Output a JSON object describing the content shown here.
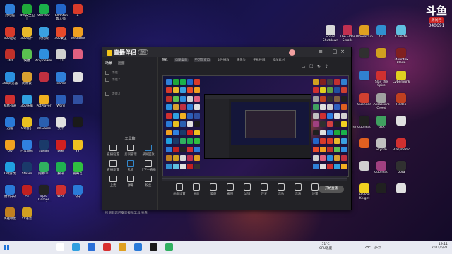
{
  "desktop": {
    "left_icons": [
      {
        "label": "此电脑",
        "color": "#2f7fd8",
        "icon": "computer-icon"
      },
      {
        "label": "360安全卫士",
        "color": "#1fa83a",
        "icon": "shield-icon"
      },
      {
        "label": "WeChat",
        "color": "#1ab04b",
        "icon": "chat-icon"
      },
      {
        "label": "UPIdoten 鲁大师",
        "color": "#2366c9",
        "icon": "app-icon"
      },
      {
        "label": "e",
        "color": "#d83a2a",
        "icon": "app-icon"
      },
      {
        "label": "360驱动",
        "color": "#d83a2a",
        "icon": "app-icon"
      },
      {
        "label": "360软件",
        "color": "#e8b82a",
        "icon": "app-icon"
      },
      {
        "label": "同花顺",
        "color": "#3aa0e0",
        "icon": "app-icon"
      },
      {
        "label": "360安全",
        "color": "#e84a2a",
        "icon": "app-icon"
      },
      {
        "label": "WeGame",
        "color": "#f0a020",
        "icon": "game-icon"
      },
      {
        "label": "360",
        "color": "#c0302a",
        "icon": "app-icon"
      },
      {
        "label": "快捷",
        "color": "#5ac050",
        "icon": "app-icon"
      },
      {
        "label": "AnyViewer",
        "color": "#2f8fe0",
        "icon": "app-icon"
      },
      {
        "label": "111",
        "color": "#d0d0d0",
        "icon": "file-icon"
      },
      {
        "label": "",
        "color": "#e06080",
        "icon": "app-icon"
      },
      {
        "label": "360浏览器",
        "color": "#2a90e0",
        "icon": "browser-icon"
      },
      {
        "label": "网易云",
        "color": "#d8a030",
        "icon": "app-icon"
      },
      {
        "label": "",
        "color": "#c03040",
        "icon": "app-icon"
      },
      {
        "label": "TeamV",
        "color": "#2f7fd8",
        "icon": "app-icon"
      },
      {
        "label": "",
        "color": "#e0e0e0",
        "icon": "file-icon"
      },
      {
        "label": "网易有道",
        "color": "#d03030",
        "icon": "app-icon"
      },
      {
        "label": "360压缩",
        "color": "#30a0e0",
        "icon": "app-icon"
      },
      {
        "label": "PotPlayer",
        "color": "#f0b020",
        "icon": "app-icon"
      },
      {
        "label": "Word",
        "color": "#2b5fb8",
        "icon": "doc-icon"
      },
      {
        "label": "",
        "color": "#3050a0",
        "icon": "app-icon"
      },
      {
        "label": "迅雷",
        "color": "#2a7ad8",
        "icon": "app-icon"
      },
      {
        "label": "QQ音乐",
        "color": "#e8c020",
        "icon": "music-icon"
      },
      {
        "label": "WeGame",
        "color": "#2a5fb0",
        "icon": "app-icon"
      },
      {
        "label": "文件",
        "color": "#e0e0e0",
        "icon": "file-icon"
      },
      {
        "label": "",
        "color": "#1a1a1a",
        "icon": "app-icon"
      },
      {
        "label": "QQ",
        "color": "#f0a020",
        "icon": "app-icon"
      },
      {
        "label": "百度网盘",
        "color": "#3080e0",
        "icon": "app-icon"
      },
      {
        "label": "Steam",
        "color": "#1a3a6a",
        "icon": "app-icon"
      },
      {
        "label": "网易",
        "color": "#d02020",
        "icon": "app-icon"
      },
      {
        "label": "YY",
        "color": "#f0c020",
        "icon": "app-icon"
      },
      {
        "label": "QQ游戏",
        "color": "#20a0e0",
        "icon": "app-icon"
      },
      {
        "label": "Steam",
        "color": "#1a3a6a",
        "icon": "app-icon"
      },
      {
        "label": "网易UU",
        "color": "#30b060",
        "icon": "app-icon"
      },
      {
        "label": "腾讯",
        "color": "#20b050",
        "icon": "app-icon"
      },
      {
        "label": "爱奇艺",
        "color": "#30c040",
        "icon": "app-icon"
      },
      {
        "label": "腾讯QQ",
        "color": "#2a7ad8",
        "icon": "app-icon"
      },
      {
        "label": "PS",
        "color": "#c02020",
        "icon": "app-icon"
      },
      {
        "label": "Epic Games Launcher",
        "color": "#222222",
        "icon": "app-icon"
      },
      {
        "label": "WPS",
        "color": "#d03030",
        "icon": "app-icon"
      },
      {
        "label": "QQ",
        "color": "#2a7ad8",
        "icon": "app-icon"
      },
      {
        "label": "英雄联盟",
        "color": "#c08020",
        "icon": "app-icon"
      },
      {
        "label": "YY语音",
        "color": "#d0a020",
        "icon": "app-icon"
      }
    ],
    "right_icons": [
      {
        "label": "Space Shutdown",
        "color": "#d8d8d8",
        "icon": "app-icon"
      },
      {
        "label": "The Elder Scrolls",
        "color": "#c03050",
        "icon": "game-icon"
      },
      {
        "label": "Bloodstained",
        "color": "#e0a020",
        "icon": "game-icon"
      },
      {
        "label": "Ori",
        "color": "#3090d0",
        "icon": "game-icon"
      },
      {
        "label": "Celeste",
        "color": "#60c0e0",
        "icon": "game-icon"
      },
      {
        "label": "Hollow Knight",
        "color": "#e0e0e0",
        "icon": "game-icon"
      },
      {
        "label": "",
        "color": "#c02020",
        "icon": "game-icon"
      },
      {
        "label": "",
        "color": "#303030",
        "icon": "game-icon"
      },
      {
        "label": "",
        "color": "#d0a020",
        "icon": "game-icon"
      },
      {
        "label": "Mount & Blade",
        "color": "#802020",
        "icon": "game-icon"
      },
      {
        "label": "Monster Hunter",
        "color": "#404040",
        "icon": "game-icon"
      },
      {
        "label": "",
        "color": "#c03030",
        "icon": "game-icon"
      },
      {
        "label": "",
        "color": "#3080d0",
        "icon": "game-icon"
      },
      {
        "label": "Slay the Spire",
        "color": "#d03030",
        "icon": "game-icon"
      },
      {
        "label": "Cyberpunk",
        "color": "#e0d020",
        "icon": "game-icon"
      },
      {
        "label": "Stardew Valley",
        "color": "#60a040",
        "icon": "game-icon"
      },
      {
        "label": "",
        "color": "#2050a0",
        "icon": "game-icon"
      },
      {
        "label": "Cuphead",
        "color": "#d04030",
        "icon": "game-icon"
      },
      {
        "label": "Assassin's Creed",
        "color": "#a0a0a0",
        "icon": "game-icon"
      },
      {
        "label": "Hades",
        "color": "#c04020",
        "icon": "game-icon"
      },
      {
        "label": "",
        "color": "#303030",
        "icon": "game-icon"
      },
      {
        "label": "Dishonored",
        "color": "#806040",
        "icon": "game-icon"
      },
      {
        "label": "Cuphead",
        "color": "#202020",
        "icon": "game-icon"
      },
      {
        "label": "GTA",
        "color": "#40a060",
        "icon": "game-icon"
      },
      {
        "label": "",
        "color": "#e0e0e0",
        "icon": "game-icon"
      },
      {
        "label": "",
        "color": "#d0d0d0",
        "icon": "game-icon"
      },
      {
        "label": "",
        "color": "#3060c0",
        "icon": "game-icon"
      },
      {
        "label": "",
        "color": "#e06020",
        "icon": "game-icon"
      },
      {
        "label": "Skyrim",
        "color": "#c0c0c0",
        "icon": "game-icon"
      },
      {
        "label": "Blasphemous",
        "color": "#d03030",
        "icon": "game-icon"
      },
      {
        "label": "Dead Cells",
        "color": "#3080e0",
        "icon": "game-icon"
      },
      {
        "label": "Diablo",
        "color": "#e0e0e0",
        "icon": "game-icon"
      },
      {
        "label": "",
        "color": "#d0d0d0",
        "icon": "game-icon"
      },
      {
        "label": "Cuphead",
        "color": "#a04080",
        "icon": "game-icon"
      },
      {
        "label": "Dota",
        "color": "#303030",
        "icon": "game-icon"
      },
      {
        "label": "",
        "color": "#d04040",
        "icon": "game-icon"
      },
      {
        "label": "",
        "color": "#202020",
        "icon": "game-icon"
      },
      {
        "label": "Hollow Knight",
        "color": "#f0d020",
        "icon": "game-icon"
      },
      {
        "label": "",
        "color": "#202020",
        "icon": "game-icon"
      },
      {
        "label": "",
        "color": "#e0e0e0",
        "icon": "game-icon"
      }
    ]
  },
  "corner_logo": {
    "mark": "斗鱼",
    "sub": "房间号",
    "num": "340691"
  },
  "app": {
    "brand": "直播伴侣",
    "badge": "直播",
    "left_tabs": [
      "场景",
      "画面"
    ],
    "scenes": [
      "场景1",
      "场景2",
      "",
      "场景3"
    ],
    "tools_title": "工具箱",
    "tools": [
      {
        "label": "直播设置",
        "icon": "settings-icon"
      },
      {
        "label": "房间管理",
        "icon": "room-icon"
      },
      {
        "label": "录屏回放",
        "icon": "replay-icon"
      },
      {
        "label": "直播设置",
        "icon": "settings-icon"
      },
      {
        "label": "礼物",
        "icon": "gift-icon"
      },
      {
        "label": "上下一直播",
        "icon": "switch-icon"
      },
      {
        "label": "上麦",
        "icon": "mic-icon"
      },
      {
        "label": "弹幕",
        "icon": "comment-icon"
      },
      {
        "label": "粉丝",
        "icon": "fan-icon"
      }
    ],
    "bottom_note": "检测到您已安装截图工具 查看",
    "toolbar": [
      "游戏",
      "电脑桌面",
      "不可见窗口",
      "文件播放",
      "摄像头",
      "手机投屏",
      "添加素材"
    ],
    "bottom_tools": [
      "画面设置",
      "画面",
      "美颜",
      "截图",
      "滤镜",
      "连麦",
      "音效",
      "音乐",
      "设置"
    ],
    "go_live": "开始直播"
  },
  "taskbar": {
    "weather": "28°C 多云",
    "temp": "51°C",
    "cpu": "CPU温度",
    "time": "19:11",
    "date": "2021/6/21"
  }
}
